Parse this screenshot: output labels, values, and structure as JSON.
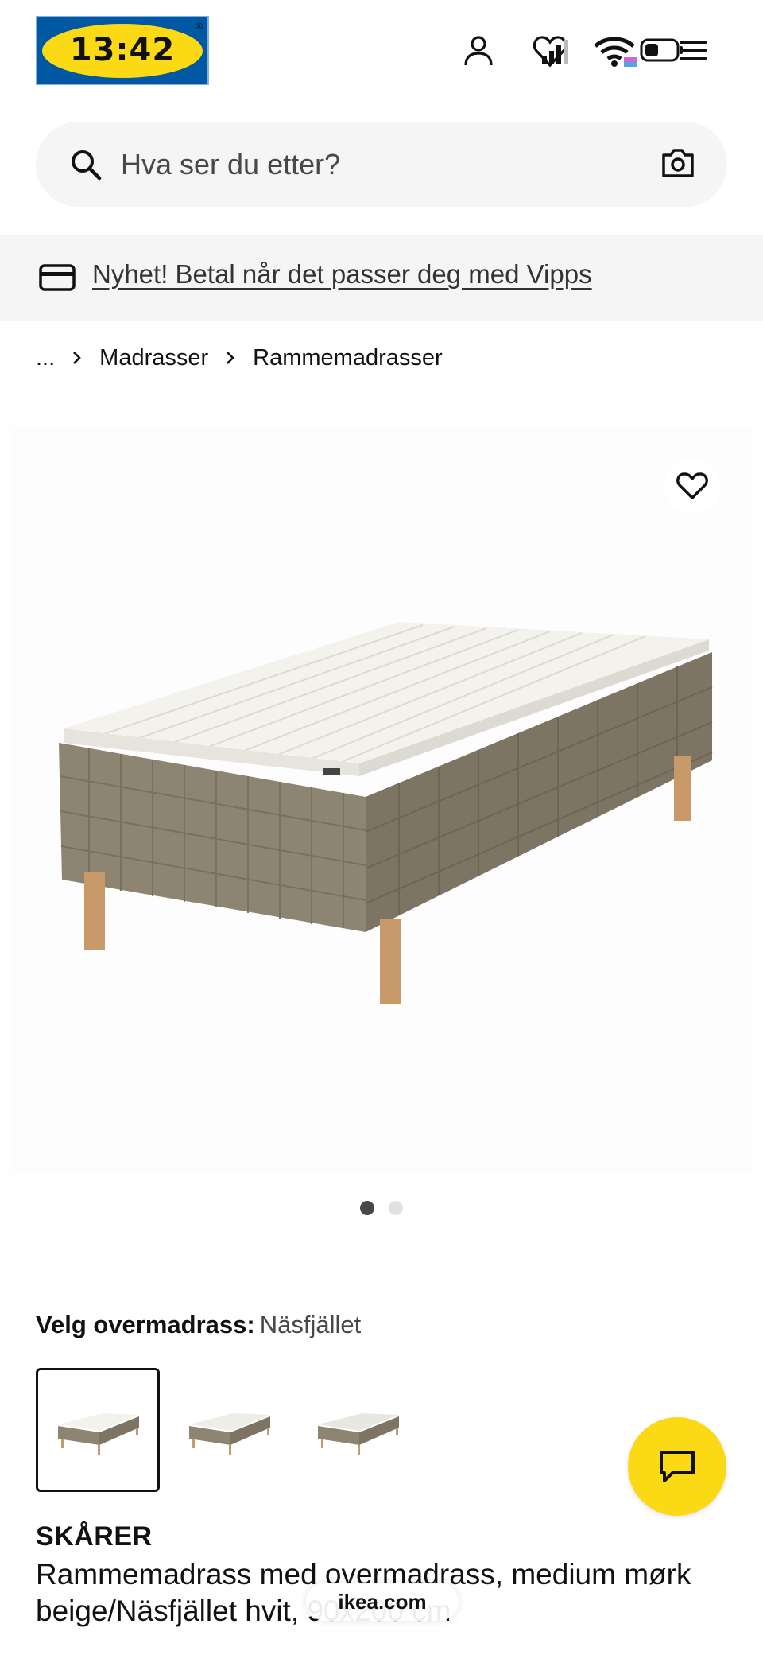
{
  "status_bar": {
    "time": "13:42"
  },
  "search": {
    "placeholder": "Hva ser du etter?"
  },
  "banner": {
    "text": "Nyhet! Betal når det passer deg med Vipps"
  },
  "breadcrumb": {
    "ellipsis": "...",
    "items": [
      "Madrasser",
      "Rammemadrasser"
    ]
  },
  "gallery": {
    "total_images": 2,
    "active_index": 0
  },
  "variant": {
    "label": "Velg overmadrass:",
    "value": "Näsfjället",
    "options_count": 3,
    "selected_index": 0
  },
  "product": {
    "name": "SKÅRER",
    "description": "Rammemadrass med overmadrass, medium mørk beige/Näsfjället hvit, 90x200 cm"
  },
  "browser": {
    "url": "ikea.com"
  },
  "colors": {
    "ikea_blue": "#0058a3",
    "ikea_yellow": "#fbd914",
    "frame_fabric": "#8e8472",
    "topper": "#f3f2ec",
    "legs": "#c89a6a"
  },
  "icons": {
    "account": "person-icon",
    "favorites": "heart-icon",
    "menu": "hamburger-icon",
    "search": "magnifier-icon",
    "camera": "camera-icon",
    "payment": "credit-card-icon",
    "chat": "chat-bubble-icon"
  }
}
